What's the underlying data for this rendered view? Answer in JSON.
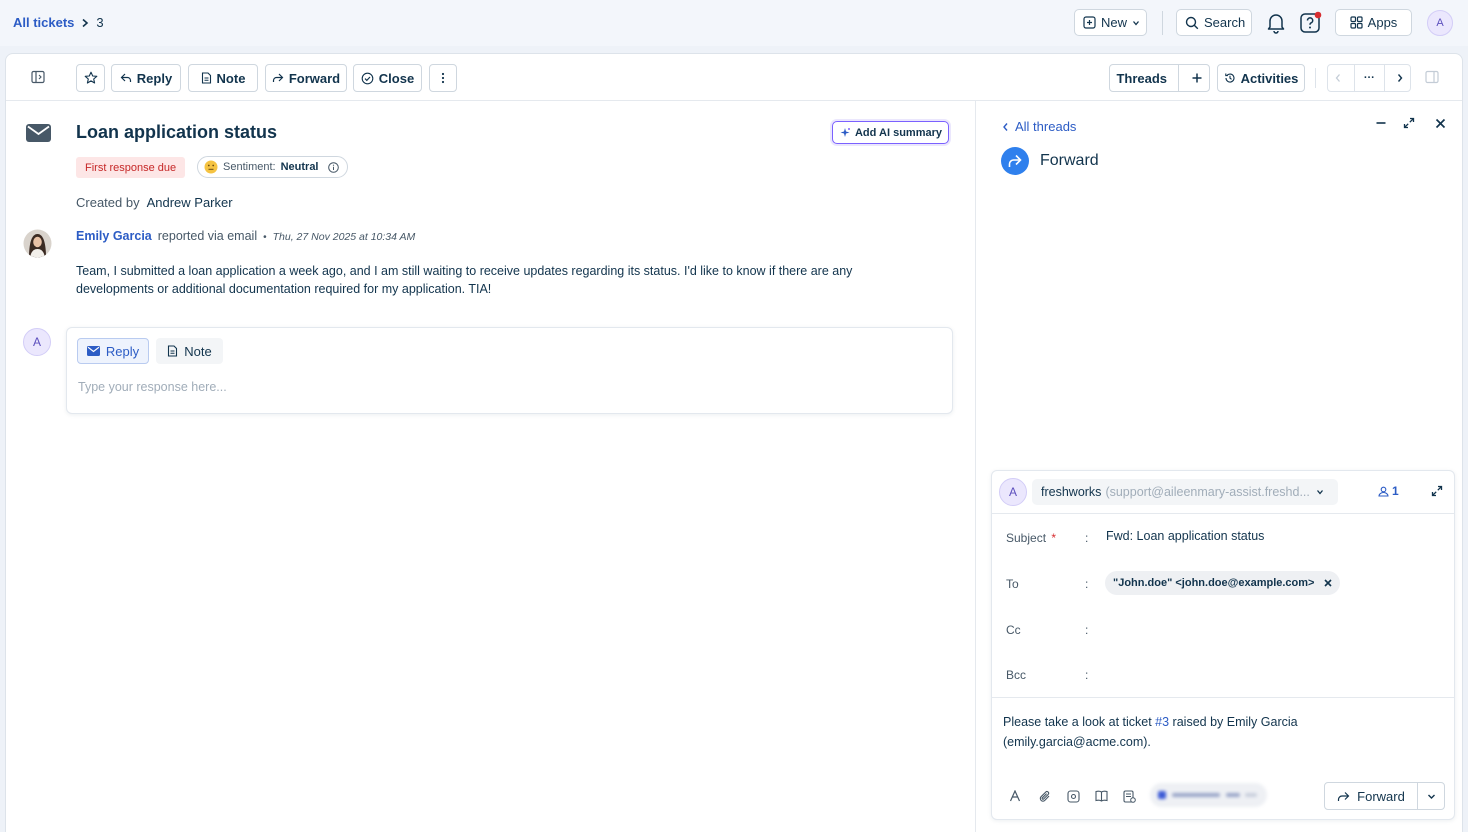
{
  "breadcrumb": {
    "root": "All tickets",
    "separator": ">",
    "current": "3"
  },
  "header": {
    "new_label": "New",
    "search_label": "Search",
    "apps_label": "Apps",
    "avatar_initial": "A"
  },
  "toolbar": {
    "reply": "Reply",
    "note": "Note",
    "forward": "Forward",
    "close": "Close",
    "threads": "Threads",
    "activities": "Activities",
    "more": "···"
  },
  "ticket": {
    "title": "Loan application status",
    "ai_summary": "Add AI summary",
    "tag_first_response": "First response due",
    "sentiment_label": "Sentiment:",
    "sentiment_value": "Neutral",
    "created_by_label": "Created by",
    "created_by_name": "Andrew Parker",
    "reporter": "Emily Garcia",
    "reported_via": "reported via email",
    "dot": "•",
    "timestamp": "Thu, 27 Nov 2025 at 10:34 AM",
    "body": "Team, I submitted a loan application a week ago, and I am still waiting to receive updates regarding its status. I'd like to know if there are any developments or additional documentation required for my application. TIA!"
  },
  "composer": {
    "avatar_initial": "A",
    "reply_tab": "Reply",
    "note_tab": "Note",
    "placeholder": "Type your response here..."
  },
  "thread_panel": {
    "back": "All threads",
    "title": "Forward"
  },
  "forward_form": {
    "avatar_initial": "A",
    "from_name": "freshworks",
    "from_email": "(support@aileenmary-assist.freshd...",
    "recipient_count": "1",
    "subject_label": "Subject",
    "required_mark": "*",
    "colon": ":",
    "subject_value": "Fwd: Loan application status",
    "to_label": "To",
    "to_chip": "\"John.doe\" <john.doe@example.com>",
    "cc_label": "Cc",
    "bcc_label": "Bcc",
    "body_part1": "Please take a look at ticket ",
    "body_link": "#3",
    "body_part2": " raised by Emily Garcia",
    "body_line2": "(emily.garcia@acme.com).",
    "send_button": "Forward"
  },
  "colors": {
    "accent": "#2c5cc5",
    "forward_icon_bg": "#2f80ed",
    "ai_border": "#7b61ff",
    "danger": "#d72d30"
  }
}
